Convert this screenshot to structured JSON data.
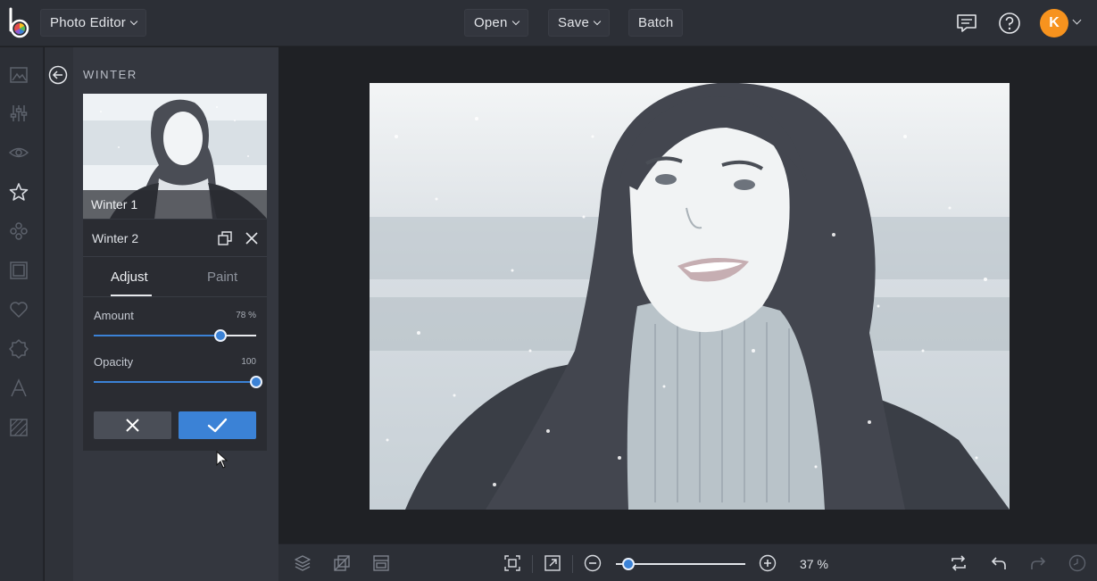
{
  "app": {
    "title_button": "Photo Editor",
    "menu": {
      "open": "Open",
      "save": "Save",
      "batch": "Batch"
    },
    "user_initial": "K"
  },
  "panel": {
    "title": "WINTER",
    "thumbnail_label": "Winter 1",
    "selected_effect": "Winter 2",
    "tabs": {
      "adjust": "Adjust",
      "paint": "Paint"
    },
    "sliders": {
      "amount": {
        "label": "Amount",
        "display": "78 %",
        "value": 78
      },
      "opacity": {
        "label": "Opacity",
        "display": "100",
        "value": 100
      }
    }
  },
  "zoom": {
    "display": "37 %",
    "value": 37
  },
  "colors": {
    "accent": "#3b82d6",
    "avatar": "#f7931e"
  },
  "icons": {
    "rail": [
      "image-icon",
      "sliders-icon",
      "eye-icon",
      "star-icon",
      "effects-icon",
      "frame-icon",
      "heart-icon",
      "badge-icon",
      "text-icon",
      "texture-icon"
    ],
    "bottom": [
      "layers-icon",
      "crop-layers-icon",
      "layout-icon",
      "fit-screen-icon",
      "expand-icon",
      "zoom-out-icon",
      "zoom-in-icon",
      "swap-icon",
      "undo-icon",
      "redo-icon",
      "history-icon"
    ]
  }
}
